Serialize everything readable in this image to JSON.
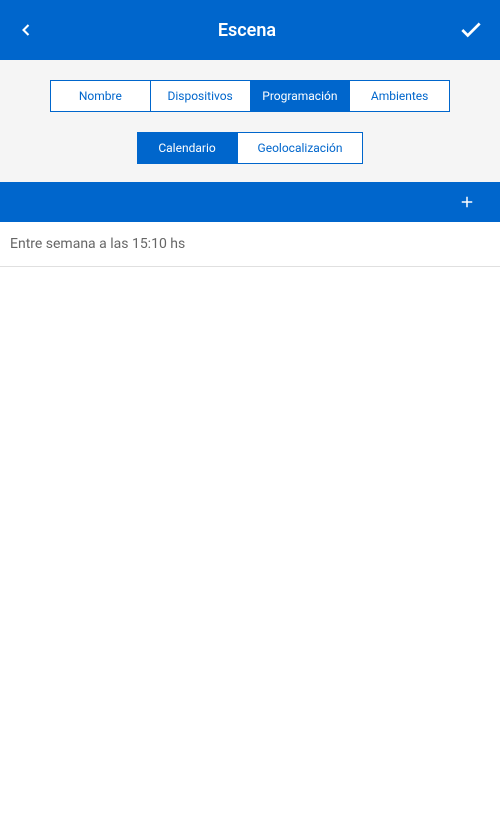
{
  "header": {
    "title": "Escena"
  },
  "tabs": {
    "items": [
      {
        "label": "Nombre"
      },
      {
        "label": "Dispositivos"
      },
      {
        "label": "Programación"
      },
      {
        "label": "Ambientes"
      }
    ],
    "activeIndex": 2
  },
  "subtabs": {
    "items": [
      {
        "label": "Calendario"
      },
      {
        "label": "Geolocalización"
      }
    ],
    "activeIndex": 0
  },
  "schedules": {
    "items": [
      {
        "text": "Entre semana a las 15:10 hs"
      }
    ]
  },
  "colors": {
    "primary": "#0066cc"
  }
}
